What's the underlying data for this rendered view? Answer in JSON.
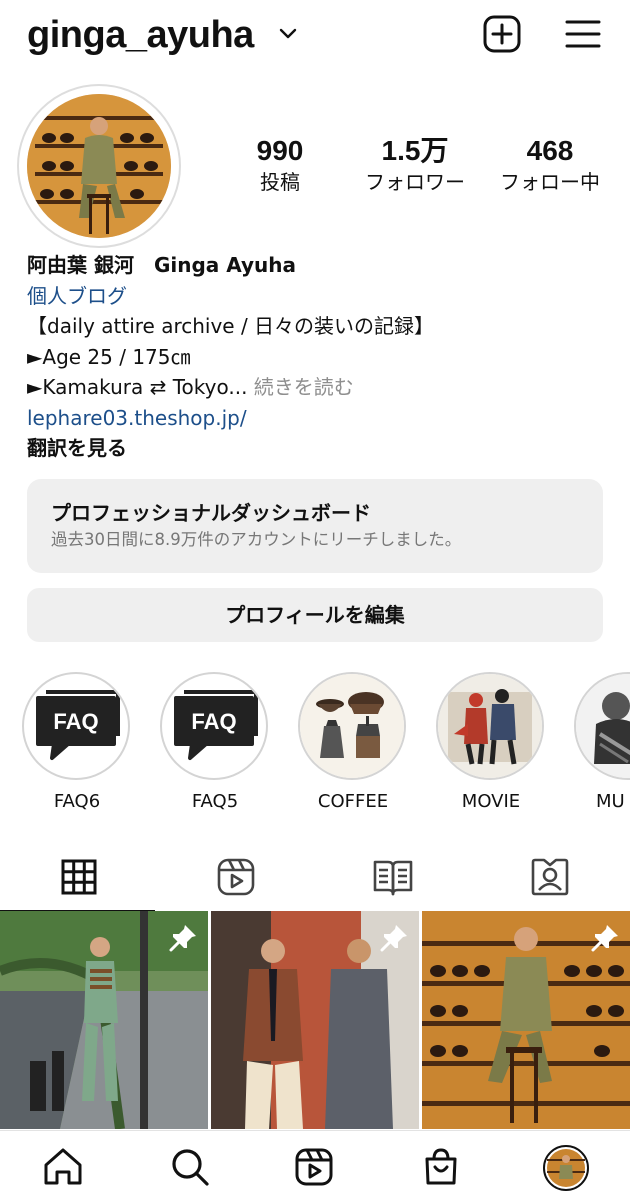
{
  "header": {
    "username": "ginga_ayuha",
    "icons": [
      "chevron-down-icon",
      "new-post-icon",
      "menu-icon"
    ]
  },
  "stats": [
    {
      "value": "990",
      "label": "投稿"
    },
    {
      "value": "1.5万",
      "label": "フォロワー"
    },
    {
      "value": "468",
      "label": "フォロー中"
    }
  ],
  "bio": {
    "name": "阿由葉 銀河　Ginga Ayuha",
    "category": "個人ブログ",
    "line1": "【daily attire archive / 日々の装いの記録】",
    "line2": "►Age 25 / 175㎝",
    "line3": "►Kamakura ⇄ Tokyo...",
    "more": " 続きを読む",
    "link": "lephare03.theshop.jp/",
    "translate": "翻訳を見る"
  },
  "dashboard": {
    "title": "プロフェッショナルダッシュボード",
    "subtitle": "過去30日間に8.9万件のアカウントにリーチしました。"
  },
  "edit_profile": "プロフィールを編集",
  "highlights": [
    {
      "label": "FAQ6"
    },
    {
      "label": "FAQ5"
    },
    {
      "label": "COFFEE"
    },
    {
      "label": "MOVIE"
    },
    {
      "label": "MU"
    }
  ],
  "faq_icon_text": "FAQ",
  "tabs": [
    "grid-icon",
    "reels-icon",
    "guide-icon",
    "tagged-icon"
  ],
  "bottom_nav": [
    "home-icon",
    "search-icon",
    "reels-icon",
    "shop-icon",
    "profile-avatar"
  ],
  "colors": {
    "link": "#1d4f8a",
    "muted": "#8e8e8e",
    "panel": "#efefef"
  }
}
